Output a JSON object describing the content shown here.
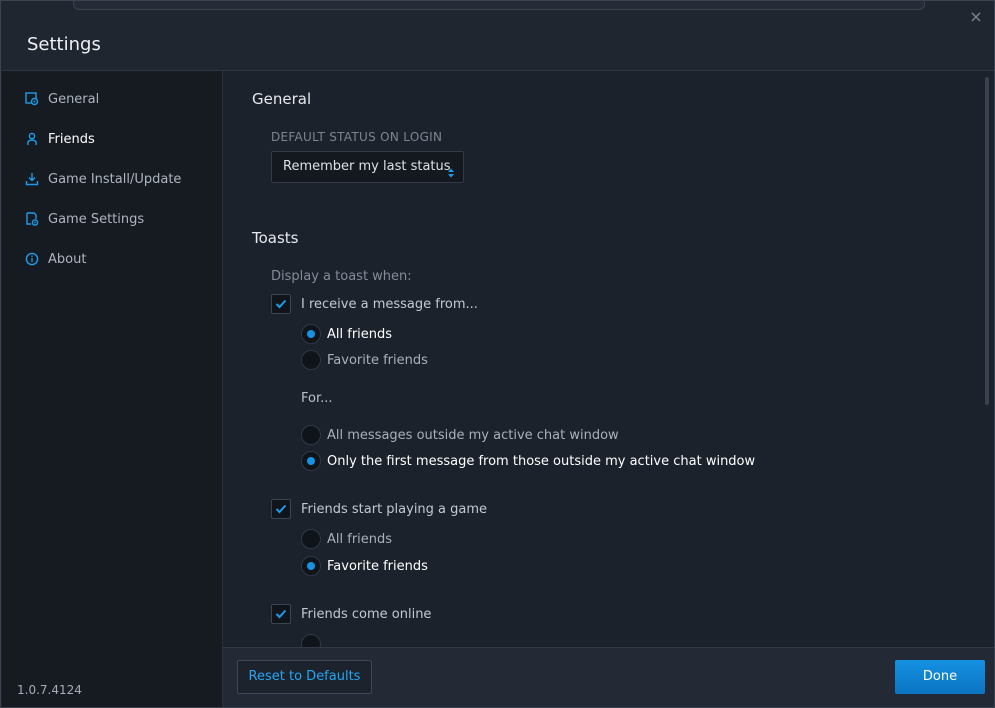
{
  "window": {
    "title": "Settings",
    "close_icon": "×"
  },
  "sidebar": {
    "items": [
      {
        "label": "General",
        "icon": "general-settings-icon",
        "active": false
      },
      {
        "label": "Friends",
        "icon": "friends-icon",
        "active": true
      },
      {
        "label": "Game Install/Update",
        "icon": "download-icon",
        "active": false
      },
      {
        "label": "Game Settings",
        "icon": "game-settings-icon",
        "active": false
      },
      {
        "label": "About",
        "icon": "info-icon",
        "active": false
      }
    ],
    "version": "1.0.7.4124"
  },
  "general": {
    "title": "General",
    "status_label": "DEFAULT STATUS ON LOGIN",
    "status_value": "Remember my last status"
  },
  "toasts": {
    "title": "Toasts",
    "hint": "Display a toast when:",
    "message": {
      "label": "I receive a message from...",
      "checked": true,
      "options": [
        {
          "label": "All friends",
          "selected": true
        },
        {
          "label": "Favorite friends",
          "selected": false
        }
      ],
      "for_label": "For...",
      "for_options": [
        {
          "label": "All messages outside my active chat window",
          "selected": false
        },
        {
          "label": "Only the first message from those outside my active chat window",
          "selected": true
        }
      ]
    },
    "playing": {
      "label": "Friends start playing a game",
      "checked": true,
      "options": [
        {
          "label": "All friends",
          "selected": false
        },
        {
          "label": "Favorite friends",
          "selected": true
        }
      ]
    },
    "online": {
      "label": "Friends come online",
      "checked": true
    }
  },
  "footer": {
    "reset_label": "Reset to Defaults",
    "done_label": "Done"
  },
  "colors": {
    "accent": "#1793e6",
    "link": "#25a6f2",
    "background": "#1c222c",
    "sidebar": "#161b22"
  }
}
